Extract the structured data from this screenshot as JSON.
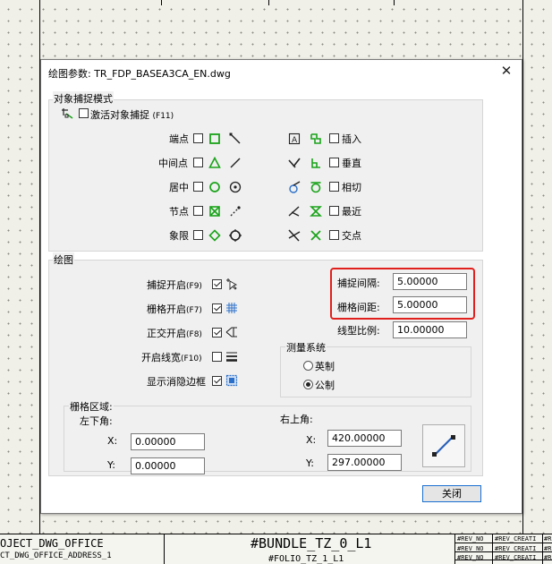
{
  "dialog": {
    "title": "绘图参数: TR_FDP_BASEA3CA_EN.dwg",
    "close_glyph": "✕"
  },
  "osnap": {
    "group_label": "对象捕捉模式",
    "activate_label": "激活对象捕捉",
    "activate_key": "(F11)",
    "activate_checked": false,
    "left_items": [
      {
        "label": "端点",
        "checked": false
      },
      {
        "label": "中间点",
        "checked": false
      },
      {
        "label": "居中",
        "checked": false
      },
      {
        "label": "节点",
        "checked": false
      },
      {
        "label": "象限",
        "checked": false
      }
    ],
    "right_items": [
      {
        "label": "插入",
        "checked": false
      },
      {
        "label": "垂直",
        "checked": false
      },
      {
        "label": "相切",
        "checked": false
      },
      {
        "label": "最近",
        "checked": false
      },
      {
        "label": "交点",
        "checked": false
      }
    ]
  },
  "drawing": {
    "group_label": "绘图",
    "toggles": [
      {
        "label": "捕捉开启",
        "key": "(F9)",
        "checked": true
      },
      {
        "label": "栅格开启",
        "key": "(F7)",
        "checked": true
      },
      {
        "label": "正交开启",
        "key": "(F8)",
        "checked": true
      },
      {
        "label": "开启线宽",
        "key": "(F10)",
        "checked": false
      },
      {
        "label": "显示消隐边框",
        "key": "",
        "checked": true
      }
    ],
    "snap_spacing_label": "捕捉间隔:",
    "snap_spacing_value": "5.00000",
    "grid_spacing_label": "栅格间距:",
    "grid_spacing_value": "5.00000",
    "linetype_scale_label": "线型比例:",
    "linetype_scale_value": "10.00000",
    "measure": {
      "label": "测量系统",
      "options": [
        {
          "label": "英制",
          "selected": false
        },
        {
          "label": "公制",
          "selected": true
        }
      ]
    },
    "grid_area": {
      "label": "栅格区域:",
      "lower_left_label": "左下角:",
      "upper_right_label": "右上角:",
      "ll_x_label": "X:",
      "ll_x_value": "0.00000",
      "ll_y_label": "Y:",
      "ll_y_value": "0.00000",
      "ur_x_label": "X:",
      "ur_x_value": "420.00000",
      "ur_y_label": "Y:",
      "ur_y_value": "297.00000"
    }
  },
  "buttons": {
    "close_label": "关闭"
  },
  "title_block": {
    "office": "OJECT_DWG_OFFICE",
    "office_address": "CT_DWG_OFFICE_ADDRESS_1",
    "bundle": "#BUNDLE_TZ_0_L1",
    "folio": "#FOLIO_TZ_1_L1",
    "rev_no": "#REV_NO",
    "rev_creat": "#REV_CREATI",
    "rev_b": "#R"
  },
  "colors": {
    "highlight": "#e0201c",
    "osnap_green": "#1aa31a",
    "button_border": "#1a6fd0"
  }
}
